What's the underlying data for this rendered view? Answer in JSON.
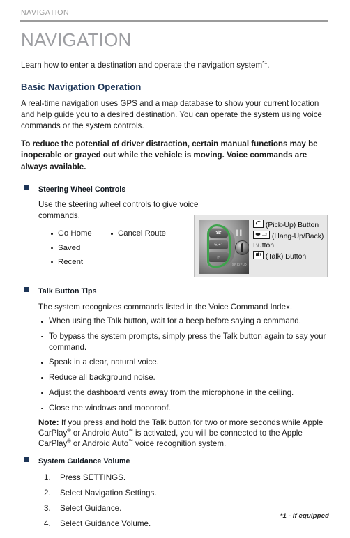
{
  "running_header": "NAVIGATION",
  "chapter_title": "NAVIGATION",
  "intro": {
    "text": "Learn how to enter a destination and operate the navigation system",
    "superscript": "*1",
    "period": "."
  },
  "section_heading": "Basic Navigation Operation",
  "paragraphs": {
    "overview": "A real-time navigation uses GPS and a map database to show your current location and help guide you to a desired destination. You can operate the system using voice commands or the system controls.",
    "warning": "To reduce the potential of driver distraction, certain manual functions may be inoperable or grayed out while the vehicle is moving. Voice commands are always available."
  },
  "steering_wheel": {
    "heading": "Steering Wheel Controls",
    "description": "Use the steering wheel controls to give voice commands.",
    "commands_col1": [
      "Go Home",
      "Saved",
      "Recent"
    ],
    "commands_col2": [
      "Cancel Route"
    ],
    "figure": {
      "legend": [
        {
          "icon": "pick-up-icon",
          "label": "(Pick-Up) Button"
        },
        {
          "icon": "hang-up-back-icon",
          "label": "(Hang-Up/Back)"
        },
        {
          "icon": "",
          "label": "Button"
        },
        {
          "icon": "talk-icon",
          "label": "(Talk) Button"
        }
      ],
      "highlight_color": "#3fa34d",
      "corner_tag": "SRC/FLD"
    }
  },
  "talk_tips": {
    "heading": "Talk Button Tips",
    "intro": "The system recognizes commands listed in the Voice Command Index.",
    "items": [
      "When using the Talk button, wait for a beep before saying a command.",
      "To bypass the system prompts, simply press the Talk button again to say your command.",
      "Speak in a clear, natural voice.",
      "Reduce all background noise.",
      "Adjust the dashboard vents away from the microphone in the ceiling.",
      "Close the windows and moonroof."
    ],
    "note": {
      "label": "Note",
      "separator": ":",
      "part1": " If you press and hold the Talk button for two or more seconds while Apple CarPlay",
      "reg1": "®",
      "part2": " or Android Auto",
      "tm1": "™",
      "part3": " is activated, you will be connected to the Apple CarPlay",
      "reg2": "®",
      "part4": " or Android Auto",
      "tm2": "™",
      "part5": " voice recognition system."
    }
  },
  "guidance_volume": {
    "heading": "System Guidance Volume",
    "steps": [
      "Press SETTINGS.",
      "Select Navigation Settings.",
      "Select Guidance.",
      "Select Guidance Volume."
    ]
  },
  "footnote": "*1 - If equipped",
  "colors": {
    "header_gray": "#9b9b9b",
    "title_gray": "#9d9ea2",
    "accent_navy": "#1d3557",
    "body_text": "#1c1c1c",
    "figure_bg": "#e7e7e7",
    "figure_border": "#bdbdbd",
    "highlight_green": "#3fa34d"
  }
}
